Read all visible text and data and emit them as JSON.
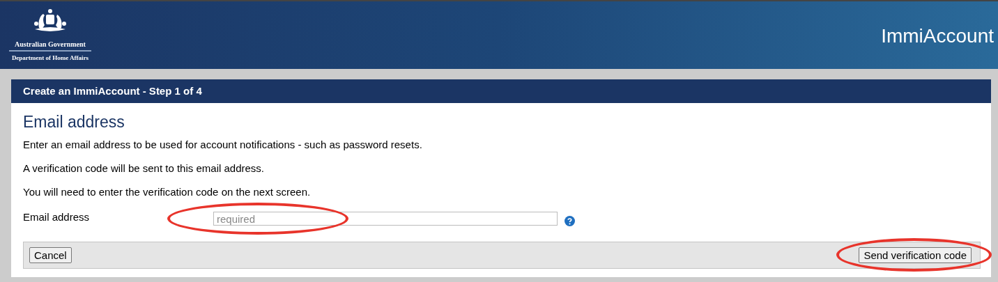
{
  "header": {
    "agency_line_1": "Australian Government",
    "agency_line_2": "Department of Home Affairs",
    "app_name": "ImmiAccount"
  },
  "panel": {
    "title": "Create an ImmiAccount - Step 1 of 4",
    "heading": "Email address",
    "paragraphs": [
      "Enter an email address to be used for account notifications - such as password resets.",
      "A verification code will be sent to this email address.",
      "You will need to enter the verification code on the next screen."
    ],
    "field": {
      "label": "Email address",
      "placeholder": "required"
    },
    "buttons": [
      {
        "label": "Cancel",
        "kind": "secondary"
      },
      {
        "label": "Send verification code",
        "kind": "primary"
      }
    ]
  }
}
